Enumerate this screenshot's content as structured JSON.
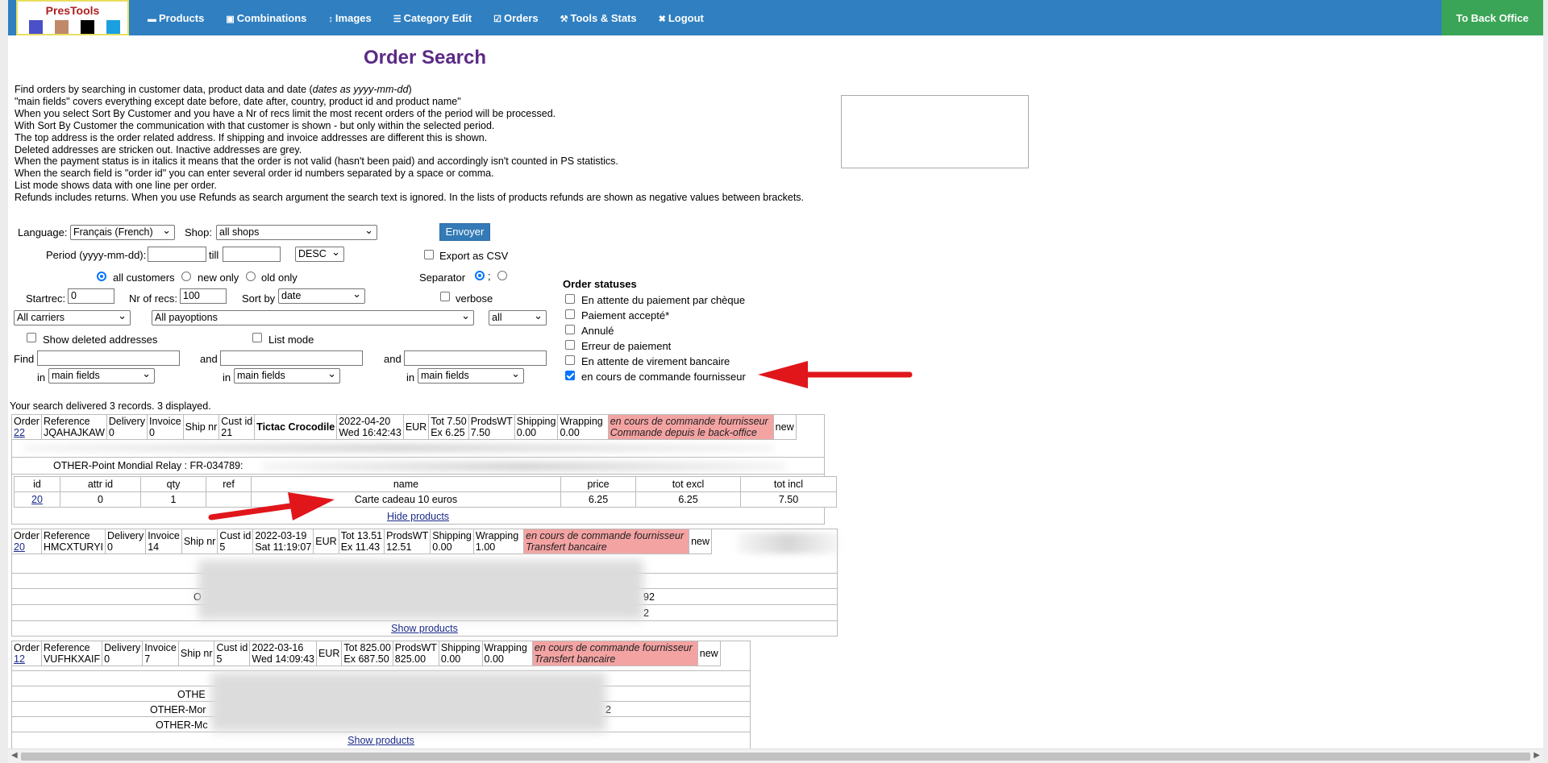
{
  "logo": {
    "title": "PresTools",
    "swatches": [
      "#4a50c8",
      "#c08a6a",
      "#000000",
      "#1aa0e0"
    ]
  },
  "nav": [
    {
      "icon": "▬",
      "label": "Products"
    },
    {
      "icon": "▣",
      "label": "Combinations"
    },
    {
      "icon": "↕",
      "label": "Images"
    },
    {
      "icon": "☰",
      "label": "Category Edit"
    },
    {
      "icon": "☑",
      "label": "Orders"
    },
    {
      "icon": "⚒",
      "label": "Tools & Stats"
    },
    {
      "icon": "✖",
      "label": "Logout"
    }
  ],
  "back_office": "To Back Office",
  "page_title": "Order Search",
  "instructions": {
    "l0_pre": "Find orders by searching in customer data, product data and date (",
    "l0_em": "dates as yyyy-mm-dd",
    "l0_post": ")",
    "l1": "\"main fields\" covers everything except date before, date after, country, product id and product name\"",
    "l2": "When you select Sort By Customer and you have a Nr of recs limit the most recent orders of the period will be processed.",
    "l3": "With Sort By Customer the communication with that customer is shown - but only within the selected period.",
    "l4": "The top address is the order related address. If shipping and invoice addresses are different this is shown.",
    "l5": "Deleted addresses are stricken out. Inactive addresses are grey.",
    "l6": "When the payment status is in italics it means that the order is not valid (hasn't been paid) and accordingly isn't counted in PS statistics.",
    "l7": "When the search field is \"order id\" you can enter several order id numbers separated by a space or comma.",
    "l8": "List mode shows data with one line per order.",
    "l9": "Refunds includes returns. When you use Refunds as search argument the search text is ignored. In the lists of products refunds are shown as negative values between brackets."
  },
  "form": {
    "language_label": "Language:",
    "language_value": "Français (French)",
    "shop_label": "Shop:",
    "shop_value": "all shops",
    "send_button": "Envoyer",
    "period_label": "Period (yyyy-mm-dd):",
    "till_label": "till",
    "order_value": "DESC",
    "export_csv_label": "Export as CSV",
    "all_customers": "all customers",
    "new_only": "new only",
    "old_only": "old only",
    "separator_label": "Separator",
    "sep_opt2": ";",
    "startrec_label": "Startrec:",
    "startrec_value": "0",
    "nrrecs_label": "Nr of recs:",
    "nrrecs_value": "100",
    "sortby_label": "Sort by",
    "sortby_value": "date",
    "verbose_label": "verbose",
    "carriers_value": "All carriers",
    "payoptions_value": "All payoptions",
    "all_value": "all",
    "show_deleted_label": "Show deleted addresses",
    "list_mode_label": "List mode",
    "find_label": "Find",
    "and_label": "and",
    "in_label": "in",
    "field_value": "main fields"
  },
  "order_statuses": {
    "title": "Order statuses",
    "items": [
      {
        "label": "En attente du paiement par chèque",
        "checked": false
      },
      {
        "label": "Paiement accepté*",
        "checked": false
      },
      {
        "label": "Annulé",
        "checked": false
      },
      {
        "label": "Erreur de paiement",
        "checked": false
      },
      {
        "label": "En attente de virement bancaire",
        "checked": false
      },
      {
        "label": "en cours de commande fournisseur",
        "checked": true
      }
    ]
  },
  "result_count": "Your search delivered 3 records. 3 displayed.",
  "orders": [
    {
      "order_label": "Order",
      "order_id": "22",
      "ref_label": "Reference",
      "ref": "JQAHAJKAW",
      "delivery_label": "Delivery",
      "delivery": "0",
      "invoice_label": "Invoice",
      "invoice": "0",
      "ship_label": "Ship nr",
      "cust_label": "Cust id",
      "cust": "21",
      "customer": "Tictac Crocodile",
      "date": "2022-04-20",
      "time": "Wed 16:42:43",
      "currency": "EUR",
      "tot": "Tot 7.50",
      "ex": "Ex 6.25",
      "prodswt_label": "ProdsWT",
      "prodswt": "7.50",
      "shipping_label": "Shipping",
      "shipping": "0.00",
      "wrapping_label": "Wrapping",
      "wrapping": "0.00",
      "status": "en cours de commande fournisseur",
      "payment": "Commande depuis le back-office",
      "cust_type": "new",
      "address_text": "OTHER-Point Mondial Relay : FR-034789:",
      "products_link": "Hide products"
    },
    {
      "order_label": "Order",
      "order_id": "20",
      "ref_label": "Reference",
      "ref": "HMCXTURYI",
      "delivery_label": "Delivery",
      "delivery": "0",
      "invoice_label": "Invoice",
      "invoice": "14",
      "ship_label": "Ship nr",
      "cust_label": "Cust id",
      "cust": "5",
      "date": "2022-03-19",
      "time": "Sat 11:19:07",
      "currency": "EUR",
      "tot": "Tot 13.51",
      "ex": "Ex 11.43",
      "prodswt_label": "ProdsWT",
      "prodswt": "12.51",
      "shipping_label": "Shipping",
      "shipping": "0.00",
      "wrapping_label": "Wrapping",
      "wrapping": "1.00",
      "status": "en cours de commande fournisseur",
      "payment": "Transfert bancaire",
      "cust_type": "new",
      "addr_frag1": "O",
      "addr_frag2": "92",
      "addr_frag3": "2",
      "products_link": "Show products"
    },
    {
      "order_label": "Order",
      "order_id": "12",
      "ref_label": "Reference",
      "ref": "VUFHKXAIF",
      "delivery_label": "Delivery",
      "delivery": "0",
      "invoice_label": "Invoice",
      "invoice": "7",
      "ship_label": "Ship nr",
      "cust_label": "Cust id",
      "cust": "5",
      "date": "2022-03-16",
      "time": "Wed 14:09:43",
      "currency": "EUR",
      "tot": "Tot 825.00",
      "ex": "Ex 687.50",
      "prodswt_label": "ProdsWT",
      "prodswt": "825.00",
      "shipping_label": "Shipping",
      "shipping": "0.00",
      "wrapping_label": "Wrapping",
      "wrapping": "0.00",
      "status": "en cours de commande fournisseur",
      "payment": "Transfert bancaire",
      "cust_type": "new",
      "addr_frag1": "OTHE",
      "addr_frag2": "OTHER-Mor",
      "addr_frag3": "2",
      "addr_frag4": "OTHER-Mc",
      "products_link": "Show products"
    }
  ],
  "product_table": {
    "headers": [
      "id",
      "attr id",
      "qty",
      "ref",
      "name",
      "price",
      "tot excl",
      "tot incl"
    ],
    "row": {
      "id": "20",
      "attr_id": "0",
      "qty": "1",
      "ref": "",
      "name": "Carte cadeau 10 euros",
      "price": "6.25",
      "tot_excl": "6.25",
      "tot_incl": "7.50"
    }
  },
  "colors": {
    "nav": "#2f7fc1",
    "back_office": "#3aa556",
    "title": "#5b2a86",
    "status_bg": "#f4a3a3",
    "annotation_arrow": "#e0161b"
  }
}
